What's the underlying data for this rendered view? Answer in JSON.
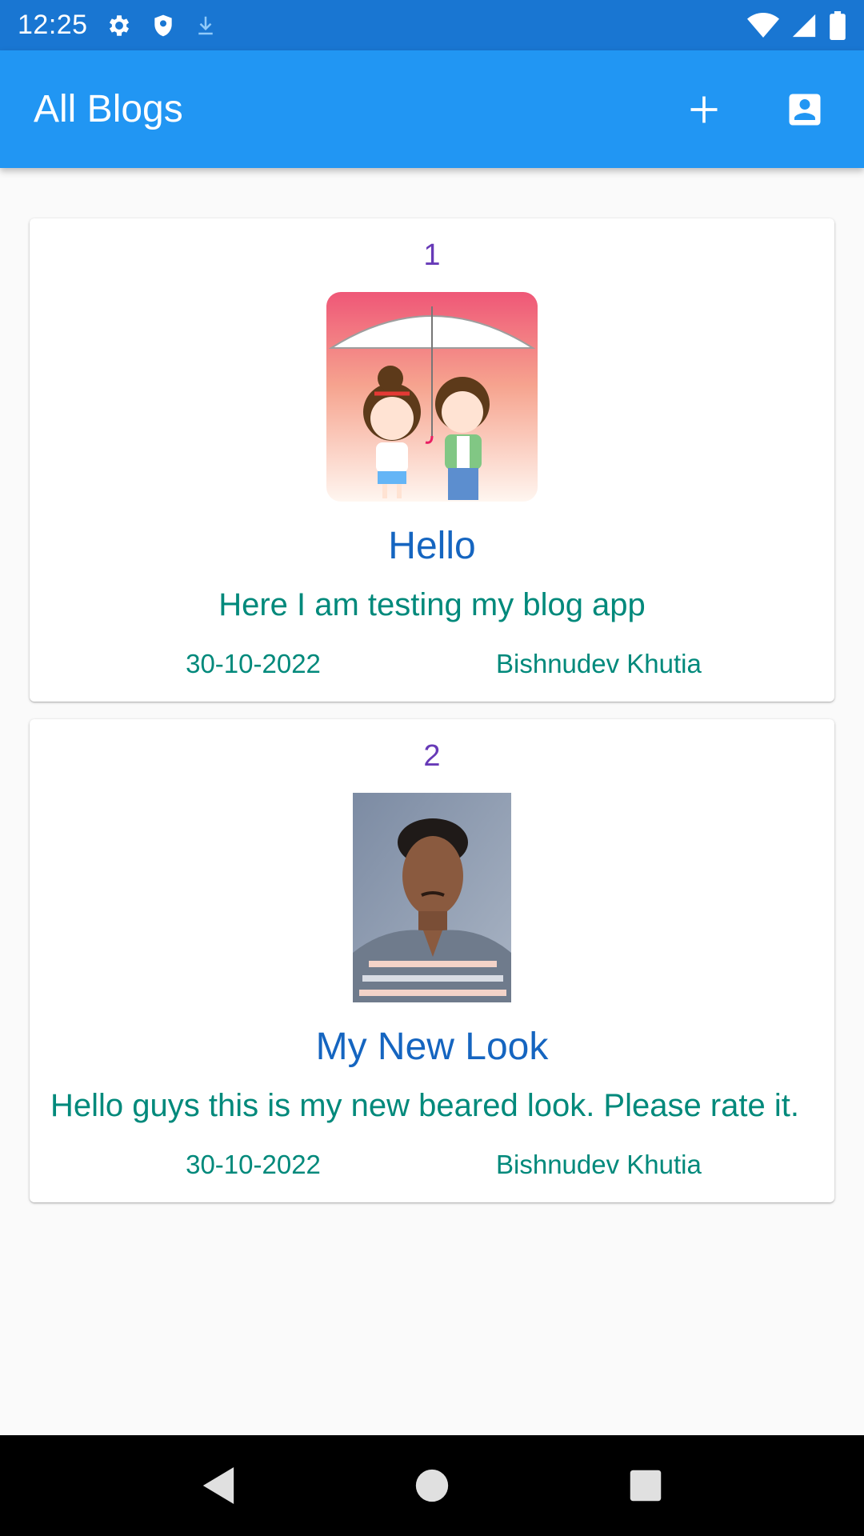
{
  "status_bar": {
    "time": "12:25",
    "icons": [
      "settings-icon",
      "shield-icon",
      "download-icon",
      "wifi-icon",
      "signal-icon",
      "battery-icon"
    ]
  },
  "app_bar": {
    "title": "All Blogs",
    "actions": [
      "add-icon",
      "account-box-icon"
    ],
    "color": "#2196f3"
  },
  "posts": [
    {
      "number": "1",
      "image": "illustration of cartoon couple under umbrella",
      "title": "Hello",
      "body": "Here I am testing my blog app",
      "date": "30-10-2022",
      "author": "Bishnudev Khutia"
    },
    {
      "number": "2",
      "image": "photo of a man in striped polo shirt",
      "title": "My New Look",
      "body": "Hello guys this is my new beared look. Please rate it.",
      "date": "30-10-2022",
      "author": "Bishnudev Khutia"
    }
  ],
  "colors": {
    "status_bar": "#1976d2",
    "number": "#673ab7",
    "title": "#1565c0",
    "body": "#00897b"
  },
  "nav_bar": {
    "buttons": [
      "back-icon",
      "home-icon",
      "recents-icon"
    ]
  }
}
